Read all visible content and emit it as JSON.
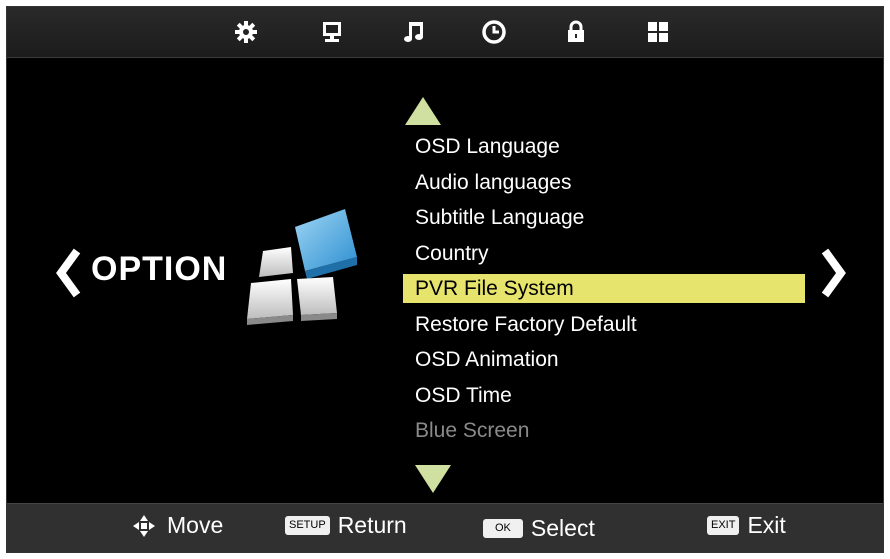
{
  "top_tabs": [
    {
      "icon": "gear-icon",
      "name": "tab-setup"
    },
    {
      "icon": "monitor-icon",
      "name": "tab-picture"
    },
    {
      "icon": "music-note-icon",
      "name": "tab-sound"
    },
    {
      "icon": "clock-icon",
      "name": "tab-time"
    },
    {
      "icon": "lock-icon",
      "name": "tab-lock"
    },
    {
      "icon": "grid-icon",
      "name": "tab-option"
    }
  ],
  "category": {
    "label": "OPTION",
    "icon": "option-blocks-icon"
  },
  "menu": {
    "items": [
      {
        "label": "OSD Language",
        "state": "normal"
      },
      {
        "label": "Audio languages",
        "state": "normal"
      },
      {
        "label": "Subtitle Language",
        "state": "normal"
      },
      {
        "label": "Country",
        "state": "normal"
      },
      {
        "label": "PVR File System",
        "state": "selected"
      },
      {
        "label": "Restore Factory Default",
        "state": "normal"
      },
      {
        "label": "OSD Animation",
        "state": "normal"
      },
      {
        "label": "OSD Time",
        "state": "normal"
      },
      {
        "label": "Blue Screen",
        "state": "disabled"
      }
    ],
    "highlight_color": "#e6e46c"
  },
  "footer": {
    "move": {
      "label": "Move",
      "icon": "move-arrows-icon"
    },
    "return": {
      "key": "SETUP",
      "label": "Return"
    },
    "select": {
      "key": "OK",
      "label": "Select"
    },
    "exit": {
      "key": "EXIT",
      "label": "Exit"
    }
  },
  "colors": {
    "background": "#000000",
    "accent_arrow": "#cfe0a0",
    "text": "#ffffff"
  }
}
